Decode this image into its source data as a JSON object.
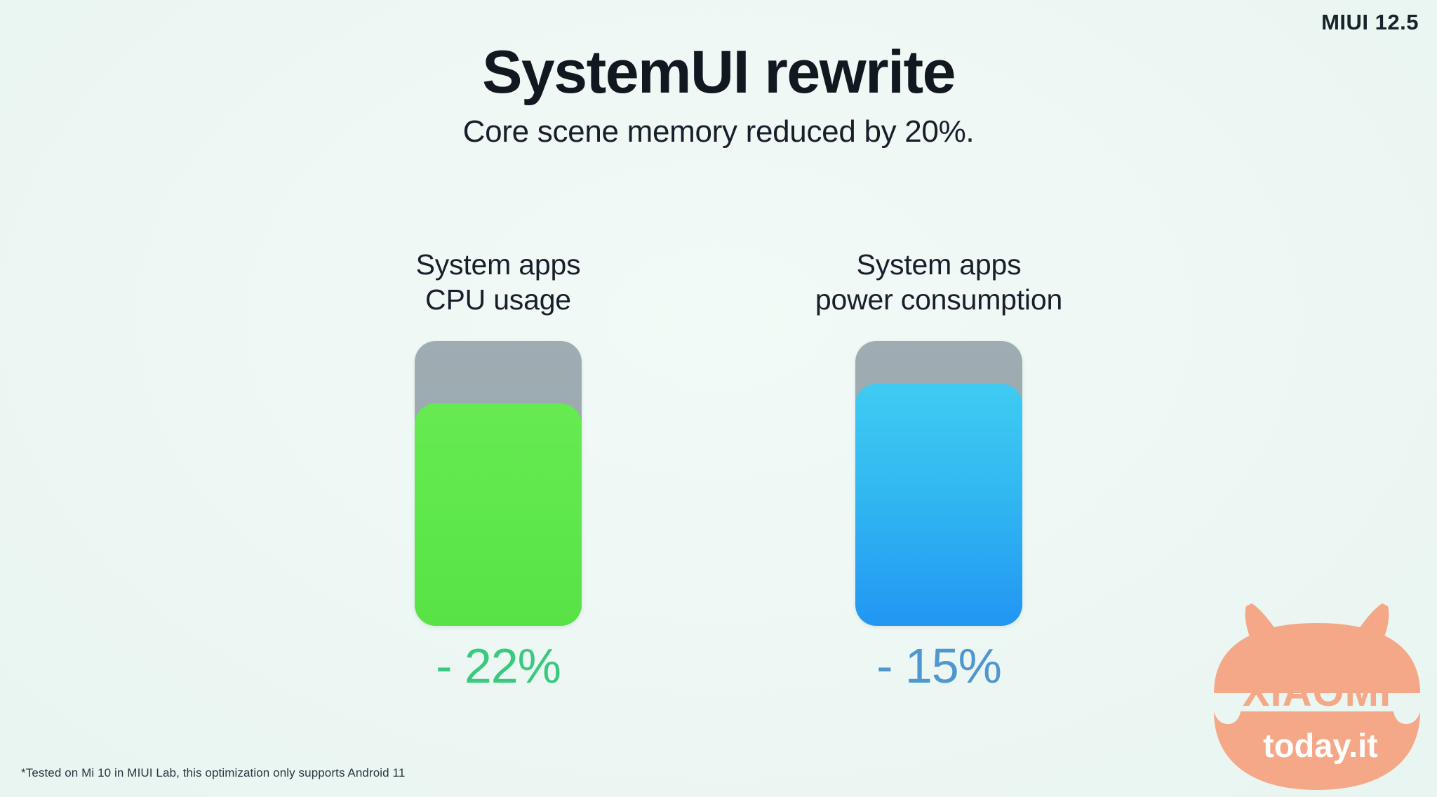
{
  "version_badge": "MIUI 12.5",
  "headline": "SystemUI rewrite",
  "subheadline": "Core scene memory reduced by 20%.",
  "footnote": "*Tested on Mi 10 in MIUI Lab, this optimization only supports Android 11",
  "watermark": {
    "brand": "XIAOMI",
    "site": "today.it",
    "color": "#f5a887"
  },
  "colors": {
    "background": "#eff8f5",
    "track_gray": "#9aa8ae",
    "green_fill_top": "#66ea51",
    "green_fill_bottom": "#58e246",
    "blue_fill_top": "#3fcbf2",
    "blue_fill_bottom": "#2196f3",
    "green_text": "#3ac97e",
    "blue_text": "#4e97d1",
    "text_dark": "#101820"
  },
  "chart_data": {
    "type": "bar",
    "title": "SystemUI rewrite",
    "subtitle": "Core scene memory reduced by 20%.",
    "categories": [
      "System apps CPU usage",
      "System apps power consumption"
    ],
    "values": [
      -22,
      -15
    ],
    "unit": "%",
    "xlabel": "",
    "ylabel": "",
    "ylim": [
      0,
      100
    ],
    "grid": false,
    "legend": "none",
    "note": "Each bar is a battery-style fill; fill height equals 100% minus the reduction.",
    "bars": [
      {
        "caption": "System apps\nCPU usage",
        "value_label": "- 22%",
        "reduction_percent": 22,
        "fill_percent": 78,
        "fill_color": "#5fe84c",
        "value_color": "#3ac97e"
      },
      {
        "caption": "System apps\npower consumption",
        "value_label": "- 15%",
        "reduction_percent": 15,
        "fill_percent": 85,
        "fill_color": "#32b8f1",
        "value_color": "#4e97d1"
      }
    ]
  }
}
